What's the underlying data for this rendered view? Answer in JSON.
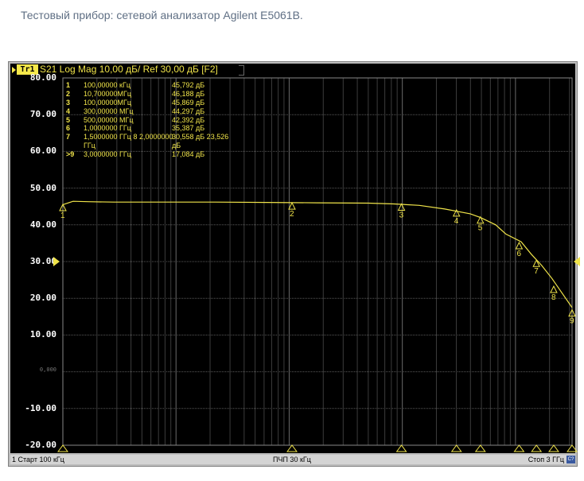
{
  "caption": "Тестовый прибор: сетевой анализатор Agilent E5061B.",
  "trace": {
    "tab": "Tr1",
    "header": "S21 Log Mag 10,00 дБ/ Ref 30,00 дБ [F2]",
    "color": "#f0e44a"
  },
  "y_axis": {
    "labels": [
      "80.00",
      "70.00",
      "60.00",
      "50.00",
      "40.00",
      "30.00",
      "20.00",
      "10.00",
      "0,000",
      "-10.00",
      "-20.00"
    ],
    "ref_label": "30.00"
  },
  "markers": [
    {
      "num": "1",
      "freq": "100,00000 кГц",
      "value": "45,792 дБ"
    },
    {
      "num": "2",
      "freq": "10,700000МГц",
      "value": "46,188 дБ"
    },
    {
      "num": "3",
      "freq": "100,00000МГц",
      "value": "45,869 дБ"
    },
    {
      "num": "4",
      "freq": "300,00000 МГц",
      "value": "44,297 дБ"
    },
    {
      "num": "5",
      "freq": "500,00000 МГц",
      "value": "42,392 дБ"
    },
    {
      "num": "6",
      "freq": "1,0000000 ГГц",
      "value": "35,387 дБ"
    },
    {
      "num": "7",
      "freq": "1,5000000 ГГц 8 2,0000000",
      "value": "30,558 дБ 23,526"
    },
    {
      "num": "",
      "freq": "ГГц",
      "value": "дБ"
    },
    {
      "num": ">9",
      "freq": "3,0000000 ГГц",
      "value": "17,084 дБ"
    }
  ],
  "status": {
    "left": "1 Старт 100 кГц",
    "mid": "ПЧП 30 кГц",
    "right": "Стоп 3 ГГц",
    "badge": "C?"
  },
  "chart_data": {
    "type": "line",
    "title": "S21 Log Mag 10,00 дБ/ Ref 30,00 дБ [F2]",
    "xlabel": "",
    "ylabel": "",
    "ylim": [
      -20,
      80
    ],
    "x_range_label": [
      "100 кГц",
      "3 ГГц"
    ],
    "grid": true,
    "series": [
      {
        "values_x_frac": [
          0.0,
          0.02,
          0.05,
          0.1,
          0.15,
          0.2,
          0.3,
          0.4,
          0.5,
          0.6,
          0.65,
          0.7,
          0.75,
          0.8,
          0.82,
          0.85,
          0.87,
          0.9,
          0.92,
          0.94,
          0.96,
          0.98,
          1.0
        ],
        "values_y": [
          45.5,
          46.4,
          46.3,
          46.2,
          46.2,
          46.2,
          46.2,
          46.1,
          46.0,
          45.9,
          45.7,
          45.3,
          44.3,
          43.0,
          42.0,
          40.0,
          37.5,
          35.4,
          32.0,
          29.0,
          25.5,
          21.5,
          17.5
        ]
      }
    ],
    "marker_points": [
      {
        "label": "1",
        "x_frac": 0.0,
        "y": 45.8
      },
      {
        "label": "2",
        "x_frac": 0.45,
        "y": 46.2
      },
      {
        "label": "3",
        "x_frac": 0.665,
        "y": 45.9
      },
      {
        "label": "4",
        "x_frac": 0.773,
        "y": 44.3
      },
      {
        "label": "5",
        "x_frac": 0.82,
        "y": 42.4
      },
      {
        "label": "6",
        "x_frac": 0.896,
        "y": 35.4
      },
      {
        "label": "7",
        "x_frac": 0.93,
        "y": 30.6
      },
      {
        "label": "8",
        "x_frac": 0.964,
        "y": 23.5
      },
      {
        "label": "9",
        "x_frac": 1.0,
        "y": 17.1
      }
    ]
  }
}
